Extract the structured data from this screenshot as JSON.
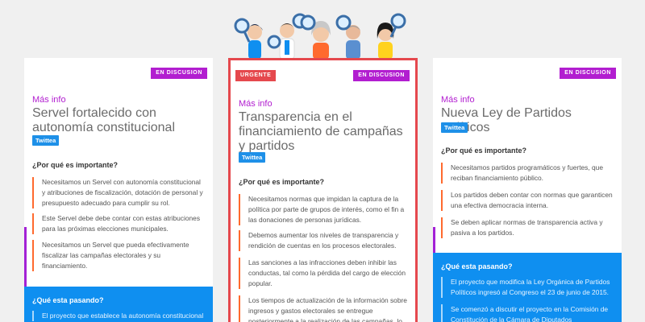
{
  "badges": {
    "discussion": "EN DISCUSION",
    "urgent": "URGENTE"
  },
  "common": {
    "mas_info": "Más info",
    "twittea": "Twittea",
    "why_heading": "¿Por qué es importante?",
    "what_heading": "¿Qué esta pasando?"
  },
  "cards": [
    {
      "title": "Servel fortalecido con autonomía constitucional",
      "bullets": [
        "Necesitamos un Servel con autonomía constitucional y atribuciones de fiscalización, dotación de personal y presupuesto adecuado para cumplir su rol.",
        "Este Servel debe debe contar con estas atribuciones para las próximas elecciones municipales.",
        "Necesitamos un Servel que pueda efectivamente fiscalizar las campañas electorales y su financiamiento."
      ],
      "what": [
        "El proyecto que establece la autonomía constitucional"
      ]
    },
    {
      "title": "Transparencia en el financiamiento de campañas y partidos",
      "bullets": [
        "Necesitamos normas que impidan la captura de la política por parte de grupos de interés, como el fin a las donaciones de personas jurídicas.",
        "Debemos aumentar los niveles de transparencia y rendición de cuentas en los procesos electorales.",
        "Las sanciones a las infracciones deben inhibir las conductas, tal como la pérdida del cargo de elección popular.",
        "Los tiempos de actualización de la información sobre ingresos y gastos electorales se entregue posteriormente a la realización de las campañas, lo"
      ]
    },
    {
      "title": "Nueva Ley de Partidos Políticos",
      "bullets": [
        "Necesitamos partidos programáticos y fuertes, que reciban financiamiento público.",
        "Los partidos deben contar con normas que garanticen una efectiva democracia interna.",
        "Se deben aplicar normas de transparencia activa y pasiva a los partidos."
      ],
      "what": [
        "El proyecto que modifica la Ley Orgánica de Partidos Políticos ingresó al Congreso el 23 de junio de 2015.",
        "Se comenzó a discutir el proyecto en la Comisión de Constitución de la Cámara de Diputados"
      ]
    }
  ],
  "colors": {
    "purple": "#b21ed0",
    "red": "#e5484d",
    "blue": "#0f8ff0",
    "orange": "#ff6a2e"
  }
}
